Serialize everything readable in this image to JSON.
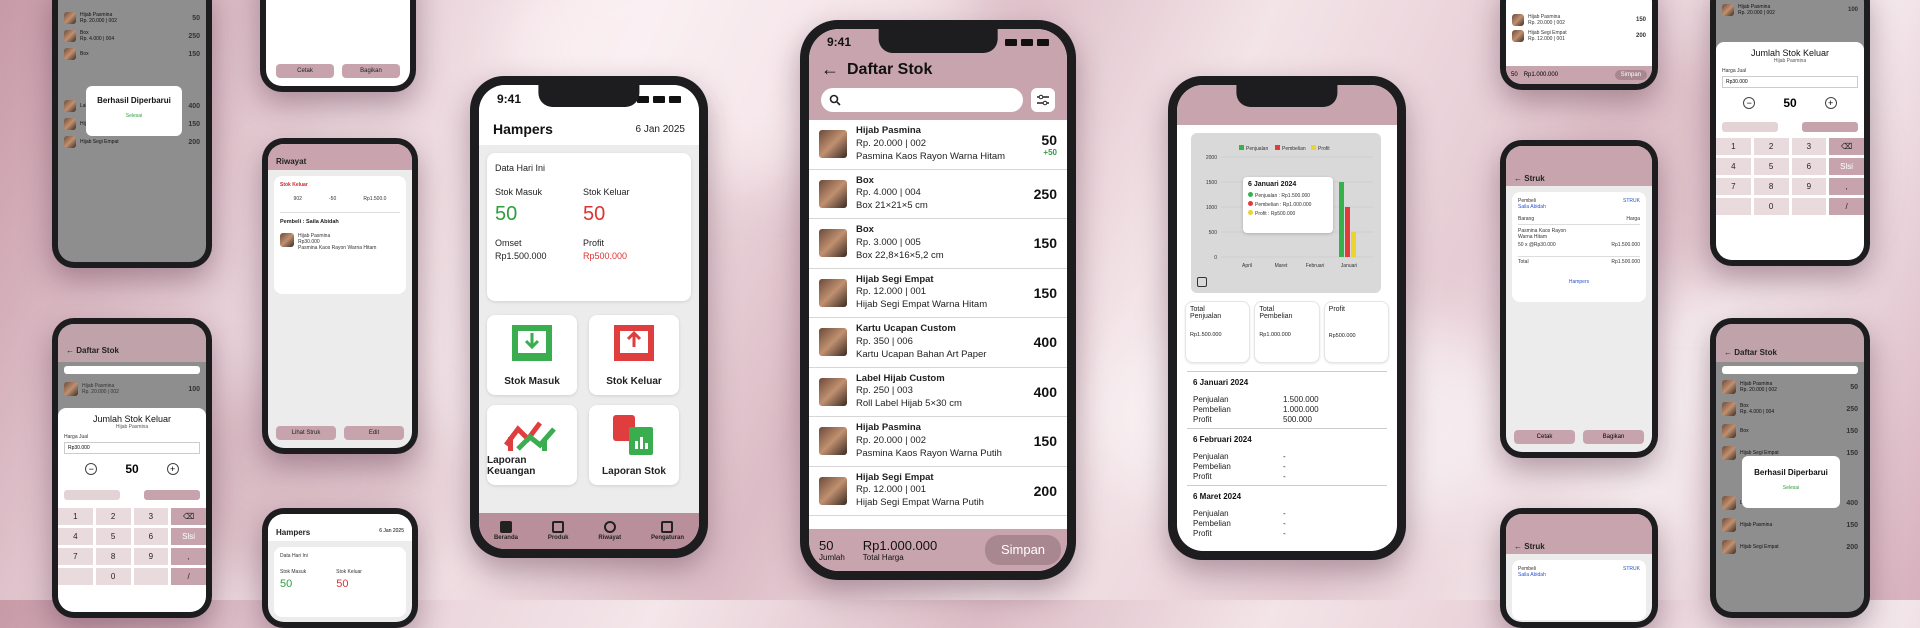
{
  "status_time": "9:41",
  "hampers": {
    "title": "Hampers",
    "date": "6 Jan 2025",
    "data_title": "Data Hari Ini",
    "stok_masuk_label": "Stok Masuk",
    "stok_masuk_value": "50",
    "stok_keluar_label": "Stok Keluar",
    "stok_keluar_value": "50",
    "omset_label": "Omset",
    "omset_value": "Rp1.500.000",
    "profit_label": "Profit",
    "profit_value": "Rp500.000",
    "tiles": [
      "Stok Masuk",
      "Stok Keluar",
      "Laporan Keuangan",
      "Laporan Stok"
    ],
    "nav": [
      "Beranda",
      "Produk",
      "Riwayat",
      "Pengaturan"
    ]
  },
  "daftar_stok": {
    "title": "Daftar Stok",
    "search_placeholder": "",
    "items": [
      {
        "name": "Hijab Pasmina",
        "meta": "Rp. 20.000 | 002",
        "desc": "Pasmina Kaos Rayon Warna Hitam",
        "qty": "50",
        "delta": "+50"
      },
      {
        "name": "Box",
        "meta": "Rp. 4.000 | 004",
        "desc": "Box 21×21×5 cm",
        "qty": "250",
        "delta": ""
      },
      {
        "name": "Box",
        "meta": "Rp. 3.000 | 005",
        "desc": "Box 22,8×16×5,2 cm",
        "qty": "150",
        "delta": ""
      },
      {
        "name": "Hijab Segi Empat",
        "meta": "Rp. 12.000 | 001",
        "desc": "Hijab Segi Empat Warna Hitam",
        "qty": "150",
        "delta": ""
      },
      {
        "name": "Kartu Ucapan Custom",
        "meta": "Rp. 350 | 006",
        "desc": "Kartu Ucapan Bahan Art Paper",
        "qty": "400",
        "delta": ""
      },
      {
        "name": "Label Hijab Custom",
        "meta": "Rp. 250 | 003",
        "desc": "Roll Label Hijab 5×30 cm",
        "qty": "400",
        "delta": ""
      },
      {
        "name": "Hijab Pasmina",
        "meta": "Rp. 20.000 | 002",
        "desc": "Pasmina Kaos Rayon Warna Putih",
        "qty": "150",
        "delta": ""
      },
      {
        "name": "Hijab Segi Empat",
        "meta": "Rp. 12.000 | 001",
        "desc": "Hijab Segi Empat Warna Putih",
        "qty": "200",
        "delta": ""
      }
    ],
    "footer_qty": "50",
    "footer_qty_label": "Jumlah",
    "footer_total": "Rp1.000.000",
    "footer_total_label": "Total Harga",
    "save_label": "Simpan"
  },
  "laporan": {
    "legend": [
      "Penjualan",
      "Pembelian",
      "Profit"
    ],
    "y_ticks": [
      "2000",
      "1500",
      "1000",
      "500",
      "0"
    ],
    "x_ticks": [
      "April",
      "Maret",
      "Februari",
      "Januari"
    ],
    "tooltip_title": "6 Januari 2024",
    "tooltip_lines": [
      "Penjualan : Rp1.500.000",
      "Pembelian : Rp1.000.000",
      "Profit : Rp500.000"
    ],
    "summary": [
      {
        "label": "Total Penjualan",
        "value": "Rp1.500.000"
      },
      {
        "label": "Total Pembelian",
        "value": "Rp1.000.000"
      },
      {
        "label": "Profit",
        "value": "Rp500.000"
      }
    ],
    "sections": [
      {
        "date": "6 Januari 2024",
        "penjualan": "1.500.000",
        "pembelian": "1.000.000",
        "profit": "500.000"
      },
      {
        "date": "6 Februari 2024",
        "penjualan": "-",
        "pembelian": "-",
        "profit": "-"
      },
      {
        "date": "6 Maret 2024",
        "penjualan": "-",
        "pembelian": "-",
        "profit": "-"
      }
    ],
    "row_labels": [
      "Penjualan",
      "Pembelian",
      "Profit"
    ],
    "colors": {
      "penjualan": "#36b24a",
      "pembelian": "#e23b3b",
      "profit": "#e9d431"
    }
  },
  "small": {
    "success_title": "Berhasil Diperbarui",
    "success_action": "Selesai",
    "riwayat_title": "Riwayat",
    "stok_keluar_tag": "Stok Keluar",
    "pembeli": "Pembeli : Saila Abidah",
    "lihat_struk": "Lihat Struk",
    "edit": "Edit",
    "cetak": "Cetak",
    "bagikan": "Bagikan",
    "struk_title": "Struk",
    "jumlah_stok_keluar": "Jumlah Stok Keluar",
    "hijab_pasmina": "Hijab Pasmina",
    "harga_jual": "Harga Jual",
    "harga_value": "Rp30.000",
    "qty": "50",
    "keypad": [
      "1",
      "2",
      "3",
      "⌫",
      "4",
      "5",
      "6",
      "Slsi",
      "7",
      "8",
      "9",
      ",",
      "",
      "0",
      "",
      "/"
    ],
    "bottom_total": "Rp1.000.000",
    "bottom_qty": "50",
    "simpan": "Simpan"
  }
}
